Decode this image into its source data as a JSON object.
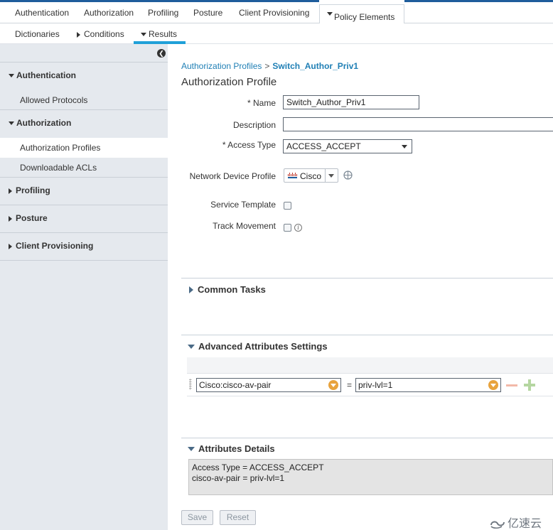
{
  "top_nav": {
    "items": [
      "Authentication",
      "Authorization",
      "Profiling",
      "Posture",
      "Client Provisioning"
    ],
    "active": "Policy Elements"
  },
  "sub_nav": {
    "items": [
      "Dictionaries",
      "Conditions"
    ],
    "active": "Results"
  },
  "sidebar": {
    "sections": [
      {
        "label": "Authentication",
        "items": [
          "Allowed Protocols"
        ]
      },
      {
        "label": "Authorization",
        "items": [
          "Authorization Profiles",
          "Downloadable ACLs"
        ]
      },
      {
        "label": "Profiling"
      },
      {
        "label": "Posture"
      },
      {
        "label": "Client Provisioning"
      }
    ],
    "selected": "Authorization Profiles"
  },
  "breadcrumb": {
    "parent": "Authorization Profiles",
    "separator": ">",
    "current": "Switch_Author_Priv1"
  },
  "page_title": "Authorization Profile",
  "form": {
    "name_label": "* Name",
    "name_value": "Switch_Author_Priv1",
    "description_label": "Description",
    "description_value": "",
    "access_type_label": "* Access Type",
    "access_type_value": "ACCESS_ACCEPT",
    "ndp_label": "Network Device Profile",
    "ndp_value": "Cisco",
    "service_template_label": "Service Template",
    "service_template_checked": false,
    "track_movement_label": "Track Movement",
    "track_movement_checked": false
  },
  "common_tasks": {
    "label": "Common Tasks"
  },
  "advanced": {
    "label": "Advanced Attributes Settings",
    "attribute": "Cisco:cisco-av-pair",
    "operator": "=",
    "value": "priv-lvl=1"
  },
  "attributes_details": {
    "label": "Attributes Details",
    "lines": [
      "Access Type = ACCESS_ACCEPT",
      "cisco-av-pair = priv-lvl=1"
    ]
  },
  "buttons": {
    "save": "Save",
    "reset": "Reset"
  },
  "watermark": "亿速云",
  "colors": {
    "nav_blue": "#1f5d9c",
    "tab_underline": "#1fa0d8",
    "link": "#1f7fb5",
    "sidebar_bg": "#e5e9ee",
    "combo_orange": "#e8a33d"
  }
}
